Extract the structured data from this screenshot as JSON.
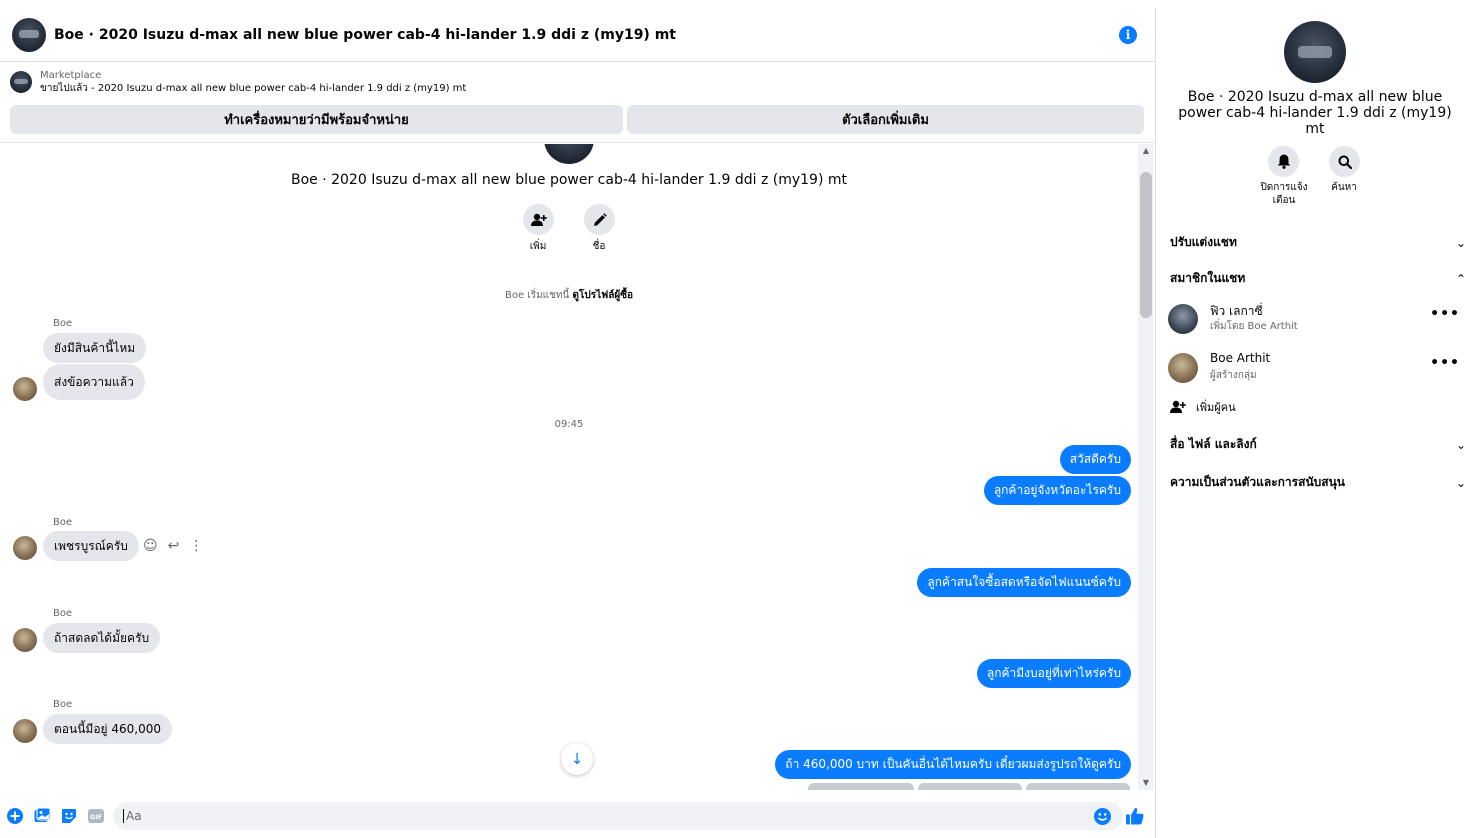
{
  "header": {
    "title": "Boe · 2020 Isuzu d-max all new blue power cab-4 hi-lander 1.9 ddi z (my19) mt",
    "info_icon": "info-icon"
  },
  "marketplace": {
    "label": "Marketplace",
    "status": "ขายไปแล้ว - 2020 Isuzu d-max all new blue power cab-4 hi-lander 1.9 ddi z (my19) mt",
    "btn_mark_available": "ทำเครื่องหมายว่ามีพร้อมจำหน่าย",
    "btn_more_options": "ตัวเลือกเพิ่มเติม"
  },
  "chat": {
    "name": "Boe · 2020 Isuzu d-max all new blue power cab-4 hi-lander 1.9 ddi z (my19) mt",
    "add_label": "เพิ่ม",
    "name_label": "ชื่อ",
    "started_text": "Boe เริ่มแชทนี้",
    "view_profile": "ดูโปรไฟล์ผู้ซื้อ",
    "timestamp": "09:45",
    "messages": [
      {
        "sender": "Boe",
        "text": "ยังมีสินค้านี้ไหม",
        "dir": "in"
      },
      {
        "sender": "",
        "text": "ส่งข้อความแล้ว",
        "dir": "in"
      },
      {
        "sender": "",
        "text": "สวัสดีครับ",
        "dir": "out"
      },
      {
        "sender": "",
        "text": "ลูกค้าอยู่จังหวัดอะไรครับ",
        "dir": "out"
      },
      {
        "sender": "Boe",
        "text": "เพชรบูรณ์ครับ",
        "dir": "in"
      },
      {
        "sender": "",
        "text": "ลูกค้าสนใจซื้อสดหรือจัดไฟแนนซ์ครับ",
        "dir": "out"
      },
      {
        "sender": "Boe",
        "text": "ถ้าสดลดได้มั้ยครับ",
        "dir": "in"
      },
      {
        "sender": "",
        "text": "ลูกค้ามีงบอยู่ที่เท่าไหร่ครับ",
        "dir": "out"
      },
      {
        "sender": "Boe",
        "text": "ตอนนี้มีอยู่ 460,000",
        "dir": "in"
      },
      {
        "sender": "",
        "text": "ถ้า 460,000 บาท เป็นคันอื่นได้ไหมครับ เดี๋ยวผมส่งรูปรถให้ดูครับ",
        "dir": "out"
      }
    ]
  },
  "composer": {
    "placeholder": "Aa"
  },
  "right_panel": {
    "title": "Boe · 2020 Isuzu d-max all new blue power cab-4 hi-lander 1.9 ddi z (my19) mt",
    "mute_label": "ปิดการแจ้งเตือน",
    "search_label": "ค้นหา",
    "sections": {
      "customize": "ปรับแต่งแชท",
      "members": "สมาชิกในแชท",
      "media": "สื่อ ไฟล์ และลิงก์",
      "privacy": "ความเป็นส่วนตัวและการสนับสนุน"
    },
    "members": [
      {
        "name": "ฟิว เลกาซี่",
        "sub": "เพิ่มโดย Boe Arthit"
      },
      {
        "name": "Boe Arthit",
        "sub": "ผู้สร้างกลุ่ม"
      }
    ],
    "add_people": "เพิ่มผู้คน"
  },
  "colors": {
    "accent": "#0a7cff",
    "bubble_in": "#e4e6eb"
  }
}
